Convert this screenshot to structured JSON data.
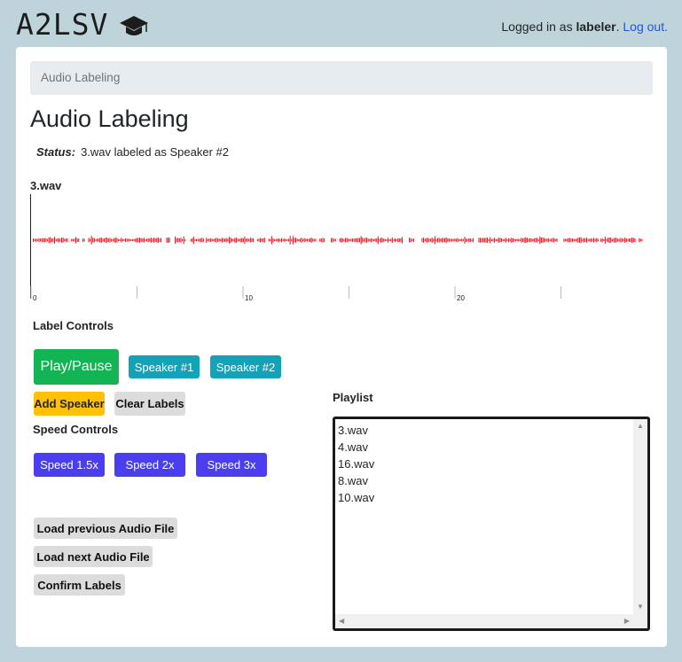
{
  "app": {
    "logo_text": "A2LSV",
    "logged_in_prefix": "Logged in as ",
    "username": "labeler",
    "logged_in_suffix": ". ",
    "logout_label": "Log out."
  },
  "breadcrumb": "Audio Labeling",
  "page_title": "Audio Labeling",
  "status": {
    "label": "Status:",
    "text": "3.wav labeled as Speaker #2"
  },
  "waveform": {
    "file": "3.wav",
    "color": "#e8202a",
    "axis": {
      "min": 0,
      "max": 29,
      "tick_labels": [
        "0",
        "10",
        "20"
      ]
    }
  },
  "label_controls": {
    "heading": "Label Controls",
    "play_pause": "Play/Pause",
    "speaker_1": "Speaker #1",
    "speaker_2": "Speaker #2",
    "add_speaker": "Add Speaker",
    "clear_labels": "Clear Labels"
  },
  "speed_controls": {
    "heading": "Speed Controls",
    "speed_15": "Speed 1.5x",
    "speed_2": "Speed 2x",
    "speed_3": "Speed 3x"
  },
  "file_controls": {
    "load_previous": "Load previous Audio File",
    "load_next": "Load next Audio File",
    "confirm": "Confirm Labels"
  },
  "playlist": {
    "heading": "Playlist",
    "items": [
      "3.wav",
      "4.wav",
      "16.wav",
      "8.wav",
      "10.wav"
    ]
  },
  "colors": {
    "background": "#bfd4da",
    "play_button": "#12b454",
    "speaker_button": "#14a2b8",
    "add_speaker_button": "#ffc107",
    "speed_button": "#4a3ef0"
  }
}
